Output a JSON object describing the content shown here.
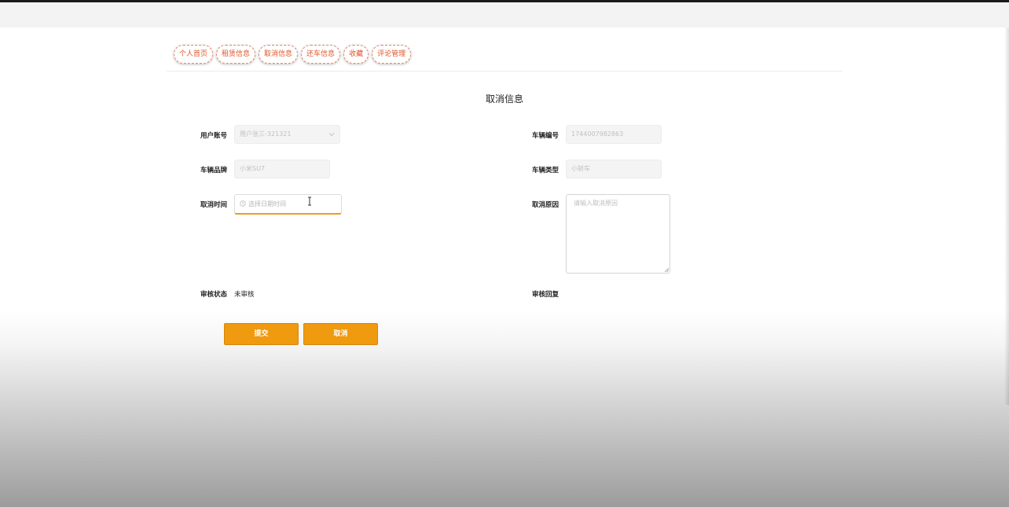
{
  "nav": {
    "tabs": [
      "个人首页",
      "租赁信息",
      "取消信息",
      "还车信息",
      "收藏",
      "评论管理"
    ]
  },
  "page": {
    "title": "取消信息"
  },
  "form": {
    "user_account": {
      "label": "用户账号",
      "value": "用户张三-321321"
    },
    "vehicle_no": {
      "label": "车辆编号",
      "value": "1744007982863"
    },
    "vehicle_brand": {
      "label": "车辆品牌",
      "value": "小米SU7"
    },
    "vehicle_type": {
      "label": "车辆类型",
      "value": "小轿车"
    },
    "cancel_time": {
      "label": "取消时间",
      "placeholder": "选择日期时间"
    },
    "cancel_reason": {
      "label": "取消原因",
      "placeholder": "请输入取消原因"
    },
    "review_status": {
      "label": "审核状态",
      "value": "未审核"
    },
    "review_reply": {
      "label": "审核回复",
      "value": ""
    }
  },
  "buttons": {
    "submit": "提交",
    "cancel": "取消"
  },
  "colors": {
    "accent": "#ef9a0f",
    "tab_text": "#e0552b",
    "focus_border": "#ef9a1f"
  },
  "icons": {
    "select_arrow": "chevron-down-icon",
    "time": "clock-icon",
    "text_cursor": "text-cursor-icon"
  }
}
